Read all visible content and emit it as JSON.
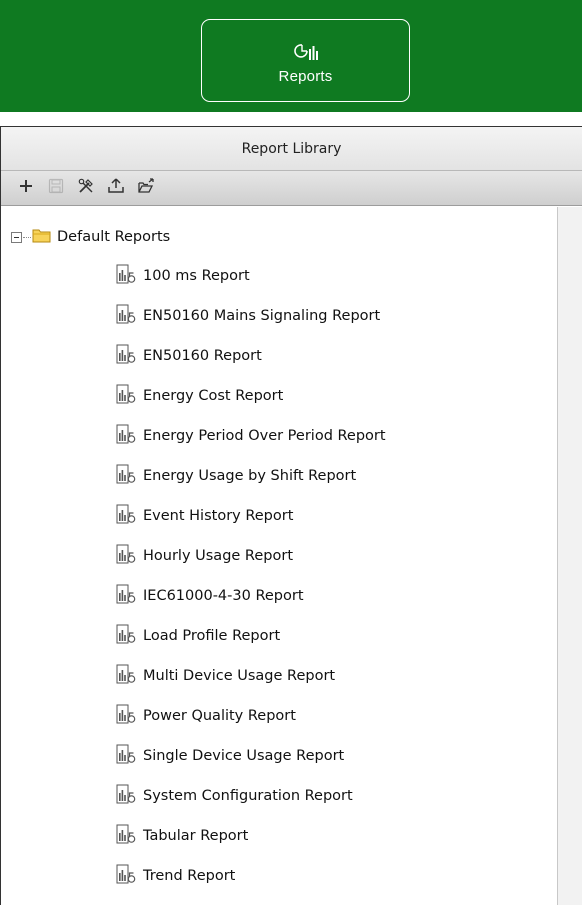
{
  "topbar": {
    "reports_button": {
      "label": "Reports",
      "icon": "reports-chart-icon"
    },
    "color": "#0f7a21"
  },
  "library": {
    "title": "Report Library",
    "toolbar": [
      {
        "name": "add-button",
        "icon": "plus-icon",
        "enabled": true
      },
      {
        "name": "save-button",
        "icon": "save-icon",
        "enabled": false
      },
      {
        "name": "tools-button",
        "icon": "tools-icon",
        "enabled": true
      },
      {
        "name": "upload-button",
        "icon": "upload-icon",
        "enabled": true
      },
      {
        "name": "export-button",
        "icon": "export-icon",
        "enabled": true
      }
    ],
    "tree": {
      "folder_label": "Default Reports",
      "expanded": true,
      "items": [
        "100 ms Report",
        "EN50160 Mains Signaling Report",
        "EN50160 Report",
        "Energy Cost Report",
        "Energy Period Over Period Report",
        "Energy Usage by Shift Report",
        "Event History Report",
        "Hourly Usage Report",
        "IEC61000-4-30 Report",
        "Load Profile Report",
        "Multi Device Usage Report",
        "Power Quality Report",
        "Single Device Usage Report",
        "System Configuration Report",
        "Tabular Report",
        "Trend Report"
      ]
    }
  }
}
